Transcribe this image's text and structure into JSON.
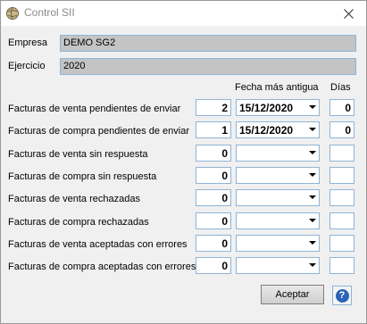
{
  "window": {
    "title": "Control SII"
  },
  "empresa": {
    "label": "Empresa",
    "value": "DEMO SG2"
  },
  "ejercicio": {
    "label": "Ejercicio",
    "value": "2020"
  },
  "columns": {
    "fecha": "Fecha más antigua",
    "dias": "Días"
  },
  "rows": [
    {
      "label": "Facturas de venta pendientes de enviar",
      "count": "2",
      "date": "15/12/2020",
      "days": "0"
    },
    {
      "label": "Facturas de compra pendientes de enviar",
      "count": "1",
      "date": "15/12/2020",
      "days": "0"
    },
    {
      "label": "Facturas de venta sin respuesta",
      "count": "0",
      "date": "",
      "days": ""
    },
    {
      "label": "Facturas de compra sin respuesta",
      "count": "0",
      "date": "",
      "days": ""
    },
    {
      "label": "Facturas de venta rechazadas",
      "count": "0",
      "date": "",
      "days": ""
    },
    {
      "label": "Facturas de compra rechazadas",
      "count": "0",
      "date": "",
      "days": ""
    },
    {
      "label": "Facturas de venta aceptadas con errores",
      "count": "0",
      "date": "",
      "days": ""
    },
    {
      "label": "Facturas de compra aceptadas con errores",
      "count": "0",
      "date": "",
      "days": ""
    }
  ],
  "buttons": {
    "accept": "Aceptar",
    "help": "?"
  },
  "icons": {
    "app": "app-globe-icon",
    "close": "close-icon",
    "help": "help-icon"
  }
}
